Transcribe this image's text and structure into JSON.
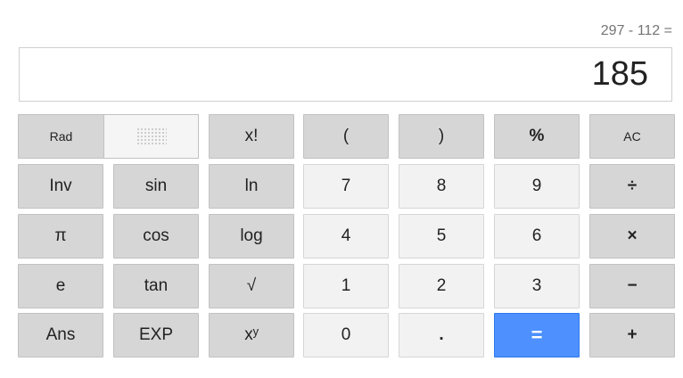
{
  "expression": "297 - 112 =",
  "result": "185",
  "mode": {
    "active": "Rad"
  },
  "keys": {
    "factorial": "x!",
    "lparen": "(",
    "rparen": ")",
    "percent": "%",
    "clear": "AC",
    "inv": "Inv",
    "sin": "sin",
    "ln": "ln",
    "seven": "7",
    "eight": "8",
    "nine": "9",
    "divide": "÷",
    "pi": "π",
    "cos": "cos",
    "log": "log",
    "four": "4",
    "five": "5",
    "six": "6",
    "multiply": "×",
    "e": "e",
    "tan": "tan",
    "sqrt": "√",
    "one": "1",
    "two": "2",
    "three": "3",
    "minus": "−",
    "ans": "Ans",
    "exp": "EXP",
    "power": "xʸ",
    "zero": "0",
    "dot": ".",
    "equals": "=",
    "plus": "+"
  }
}
